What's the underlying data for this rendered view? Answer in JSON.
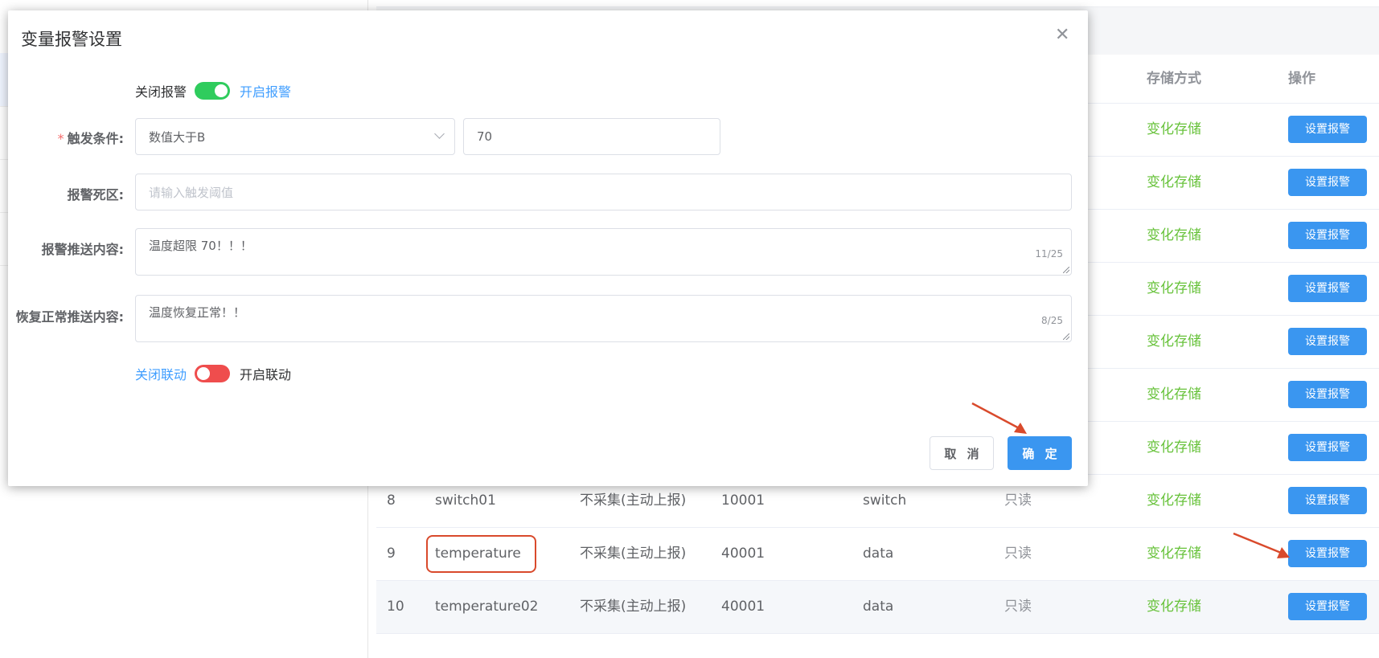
{
  "dialog": {
    "title": "变量报警设置",
    "alarm_switch": {
      "off_label": "关闭报警",
      "on_label": "开启报警",
      "checked": true
    },
    "trigger": {
      "label": "触发条件:",
      "condition_value": "数值大于B",
      "threshold_value": "70"
    },
    "deadband": {
      "label": "报警死区:",
      "placeholder": "请输入触发阈值"
    },
    "push_content": {
      "label": "报警推送内容:",
      "value": "温度超限 70！！！",
      "count": "11/25"
    },
    "recover_content": {
      "label": "恢复正常推送内容:",
      "value": "温度恢复正常！！",
      "count": "8/25"
    },
    "linkage_switch": {
      "off_label": "关闭联动",
      "on_label": "开启联动",
      "checked": false
    },
    "cancel_label": "取 消",
    "ok_label": "确 定"
  },
  "table": {
    "headers": {
      "storage": "存储方式",
      "action": "操作"
    },
    "rows": [
      {
        "id": "",
        "name": "",
        "collect": "",
        "address": "",
        "type": "",
        "access": "",
        "storage": "变化存储",
        "action": "设置报警"
      },
      {
        "id": "",
        "name": "",
        "collect": "",
        "address": "",
        "type": "",
        "access": "",
        "storage": "变化存储",
        "action": "设置报警"
      },
      {
        "id": "",
        "name": "",
        "collect": "",
        "address": "",
        "type": "",
        "access": "",
        "storage": "变化存储",
        "action": "设置报警"
      },
      {
        "id": "",
        "name": "",
        "collect": "",
        "address": "",
        "type": "",
        "access": "",
        "storage": "变化存储",
        "action": "设置报警"
      },
      {
        "id": "",
        "name": "",
        "collect": "",
        "address": "",
        "type": "",
        "access": "",
        "storage": "变化存储",
        "action": "设置报警"
      },
      {
        "id": "",
        "name": "",
        "collect": "",
        "address": "",
        "type": "",
        "access": "",
        "storage": "变化存储",
        "action": "设置报警"
      },
      {
        "id": "",
        "name": "",
        "collect": "",
        "address": "",
        "type": "",
        "access": "",
        "storage": "变化存储",
        "action": "设置报警"
      },
      {
        "id": "8",
        "name": "switch01",
        "collect": "不采集(主动上报)",
        "address": "10001",
        "type": "switch",
        "access": "只读",
        "storage": "变化存储",
        "action": "设置报警"
      },
      {
        "id": "9",
        "name": "temperature",
        "collect": "不采集(主动上报)",
        "address": "40001",
        "type": "data",
        "access": "只读",
        "storage": "变化存储",
        "action": "设置报警"
      },
      {
        "id": "10",
        "name": "temperature02",
        "collect": "不采集(主动上报)",
        "address": "40001",
        "type": "data",
        "access": "只读",
        "storage": "变化存储",
        "action": "设置报警"
      }
    ]
  },
  "colors": {
    "primary": "#3a96f0",
    "success": "#67c23a",
    "switch_on": "#2fcc5d",
    "switch_off": "#ef4d4d",
    "annotation": "#d94a2c"
  }
}
